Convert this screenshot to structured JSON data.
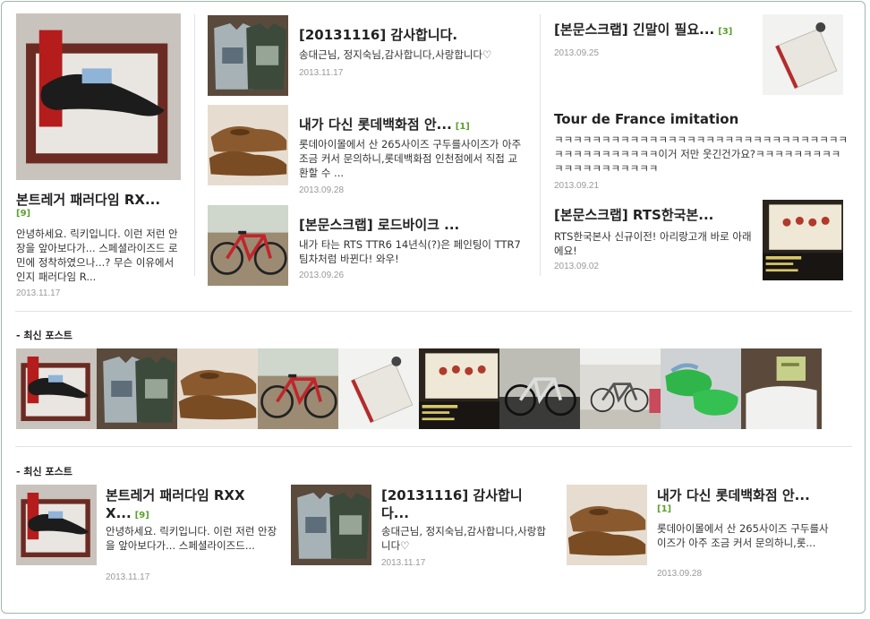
{
  "featured": {
    "title": "본트레거 패러다임 RX...",
    "count": "[9]",
    "summary": "안녕하세요. 릭키입니다. 이런 저런 안장을 앞아보다가... 스페셜라이즈드 로민에 정착하였으나...? 무슨 이유에서인지 패러다임 R...",
    "date": "2013.11.17",
    "image": "saddle-photo"
  },
  "middle_posts": [
    {
      "title": "[20131116] 감사합니다.",
      "count": "",
      "summary": "송대근님, 정지숙님,감사합니다,사랑합니다♡",
      "date": "2013.11.17",
      "image": "jersey-photo"
    },
    {
      "title": "내가 다신 롯데백화점 안...",
      "count": "[1]",
      "summary": "롯데아이몰에서 산 265사이즈 구두를사이즈가 아주 조금 커서 문의하니,롯데백화점 인천점에서 직접 교환할 수 ...",
      "date": "2013.09.28",
      "image": "shoes-photo"
    },
    {
      "title": "[본문스크랩] 로드바이크 ...",
      "count": "",
      "summary": "내가 타는 RTS TTR6 14년식(?)은 페인팅이 TTR7 팀차처럼 바뀐다! 와우!",
      "date": "2013.09.26",
      "image": "bike-photo"
    }
  ],
  "right_posts": [
    {
      "title": "[본문스크랩] 긴말이 필요...",
      "count": "[3]",
      "summary": "",
      "date": "2013.09.25",
      "image": "wallet-photo"
    },
    {
      "title": "Tour de France imitation",
      "count": "",
      "summary": "ㅋㅋㅋㅋㅋㅋㅋㅋㅋㅋㅋㅋㅋㅋㅋㅋㅋㅋㅋㅋㅋㅋㅋㅋㅋㅋㅋㅋㅋㅋㅋㅋㅋㅋㅋㅋㅋㅋㅋㅋㅋㅋ이거 저만 웃긴건가요?ㅋㅋㅋㅋㅋㅋㅋㅋㅋㅋㅋㅋㅋㅋㅋㅋㅋㅋㅋㅋ",
      "date": "2013.09.21",
      "image": ""
    },
    {
      "title": "[본문스크랩] RTS한국본...",
      "count": "",
      "summary": "RTS한국본사 신규이전! 아리랑고개 바로 아래에요!",
      "date": "2013.09.02",
      "image": "poster-photo"
    }
  ],
  "recent_strip": {
    "heading": "- 최신 포스트",
    "images": [
      "saddle-photo",
      "jersey-photo",
      "shoes-photo",
      "bike-photo",
      "wallet-photo",
      "poster-photo",
      "bike-indoor-photo",
      "bike-wall-photo",
      "green-shoes-photo",
      "box-photo"
    ]
  },
  "recent_list": {
    "heading": "- 최신 포스트",
    "items": [
      {
        "title": "본트레거 패러다임 RXX X...",
        "count": "[9]",
        "summary": "안녕하세요. 릭키입니다. 이런 저런 안장을 앞아보다가... 스페셜라이즈드...",
        "date": "2013.11.17",
        "image": "saddle-photo"
      },
      {
        "title": "[20131116] 감사합니다...",
        "count": "",
        "summary": "송대근님, 정지숙님,감사합니다,사랑합니다♡",
        "date": "2013.11.17",
        "image": "jersey-photo"
      },
      {
        "title": "내가 다신 롯데백화점 안...",
        "count": "[1]",
        "summary": "롯데아이몰에서 산 265사이즈 구두를사이즈가 아주 조금 커서 문의하니,롯...",
        "date": "2013.09.28",
        "image": "shoes-photo"
      }
    ]
  },
  "colors": {
    "border": "#9fb7a8",
    "count": "#5aa02c",
    "date": "#999999"
  }
}
